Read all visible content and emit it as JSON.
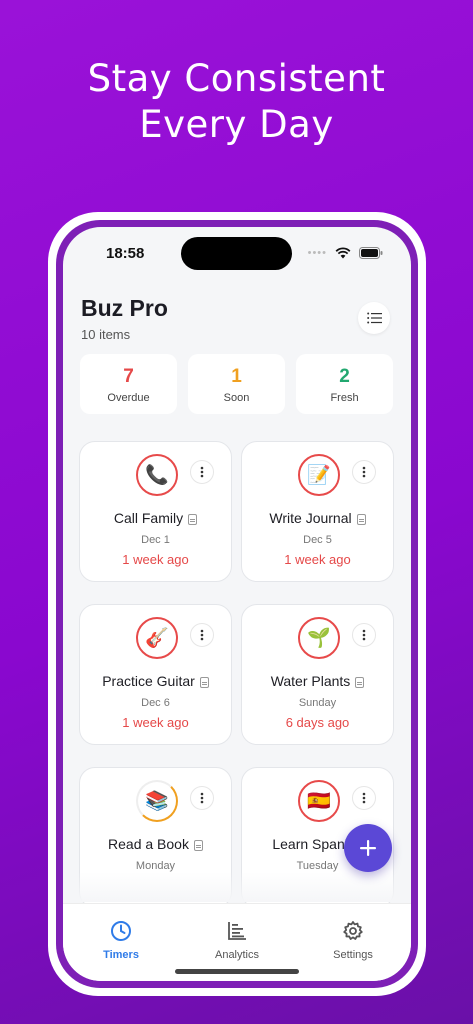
{
  "headline": {
    "line1": "Stay Consistent",
    "line2": "Every Day"
  },
  "status_bar": {
    "time": "18:58"
  },
  "header": {
    "title": "Buz Pro",
    "count": "10 items",
    "list_icon": "list-icon"
  },
  "stats": [
    {
      "value": "7",
      "label": "Overdue",
      "color": "#e54848"
    },
    {
      "value": "1",
      "label": "Soon",
      "color": "#f0a020"
    },
    {
      "value": "2",
      "label": "Fresh",
      "color": "#22a870"
    }
  ],
  "cards": [
    {
      "name": "Call Family",
      "icon": "📞",
      "date": "Dec 1",
      "ago": "1 week ago"
    },
    {
      "name": "Write Journal",
      "icon": "📝",
      "date": "Dec 5",
      "ago": "1 week ago"
    },
    {
      "name": "Practice Guitar",
      "icon": "🎸",
      "date": "Dec 6",
      "ago": "1 week ago"
    },
    {
      "name": "Water Plants",
      "icon": "🌱",
      "date": "Sunday",
      "ago": "6 days ago"
    },
    {
      "name": "Read a Book",
      "icon": "📚",
      "date": "Monday",
      "ago": ""
    },
    {
      "name": "Learn Spanish",
      "icon": "🇪🇸",
      "date": "Tuesday",
      "ago": ""
    }
  ],
  "tabs": [
    {
      "label": "Timers",
      "icon": "clock-icon",
      "active": true
    },
    {
      "label": "Analytics",
      "icon": "bar-chart-icon",
      "active": false
    },
    {
      "label": "Settings",
      "icon": "gear-icon",
      "active": false
    }
  ],
  "colors": {
    "accent": "#5b48d6",
    "active_tab": "#2f7be8",
    "background": "#8a08cf"
  }
}
